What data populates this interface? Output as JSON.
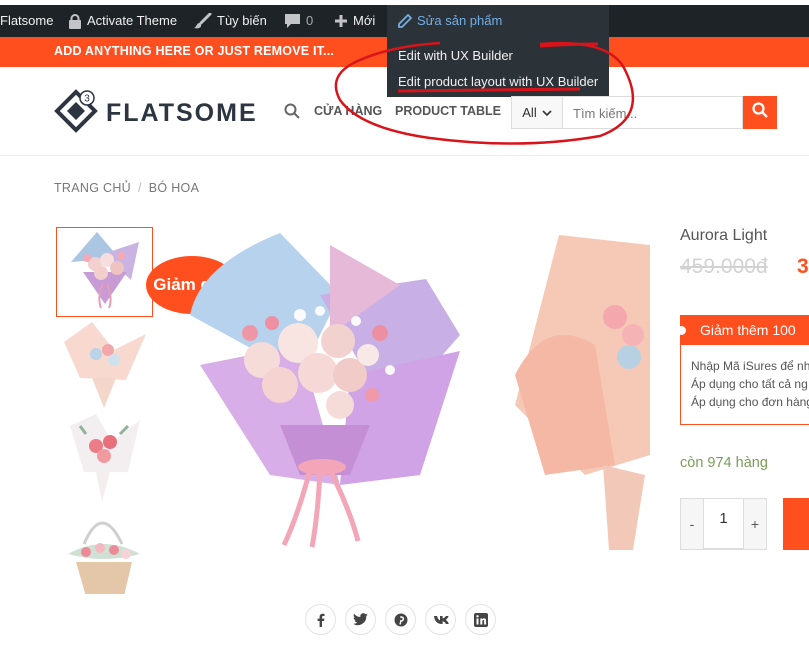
{
  "admin_bar": {
    "site_name": "Flatsome",
    "activate_theme": "Activate Theme",
    "customize": "Tùy biến",
    "comments_count": "0",
    "new": "Mới",
    "edit_product": "Sửa sản phẩm",
    "dropdown": [
      "Edit with UX Builder",
      "Edit product layout with UX Builder"
    ]
  },
  "promo_bar": {
    "text": "ADD ANYTHING HERE OR JUST REMOVE IT..."
  },
  "header": {
    "logo_text": "FLATSOME",
    "logo_badge": "3",
    "nav": [
      "CỬA HÀNG",
      "PRODUCT TABLE"
    ],
    "search": {
      "category": "All",
      "placeholder": "Tìm kiếm..."
    }
  },
  "breadcrumb": [
    "TRANG CHỦ",
    "BÓ HOA"
  ],
  "product": {
    "sale_badge": "Giảm giá!",
    "title": "Aurora Light",
    "price_old": "459.000đ",
    "price_new": "3",
    "promo": {
      "title": "Giảm thêm 100",
      "lines": [
        "Nhập Mã iSures để nh",
        "Áp dụng cho tất cả ng",
        "Áp dụng cho đơn hàng"
      ]
    },
    "stock": "còn 974 hàng",
    "quantity": {
      "minus": "-",
      "value": "1",
      "plus": "+"
    }
  },
  "share_icons": [
    "facebook-icon",
    "twitter-icon",
    "pinterest-icon",
    "vk-icon",
    "linkedin-icon"
  ],
  "colors": {
    "accent": "#ff4f1f",
    "admin_bar": "#1d2327",
    "admin_link": "#72aee6",
    "stock": "#7a9c59",
    "annotation": "#d8141a"
  }
}
